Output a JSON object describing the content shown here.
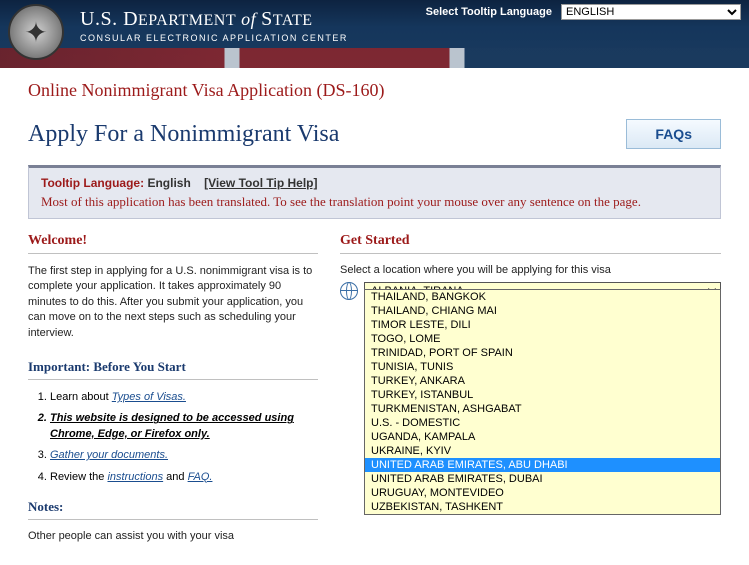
{
  "header": {
    "dept_us": "U.S. ",
    "dept_d": "D",
    "dept_ept": "EPARTMENT",
    "dept_of": " of ",
    "dept_s": "S",
    "dept_tate": "TATE",
    "sub": "CONSULAR ELECTRONIC APPLICATION CENTER",
    "tooltip_label": "Select Tooltip Language",
    "tooltip_selected": "ENGLISH"
  },
  "app_title": "Online Nonimmigrant Visa Application (DS-160)",
  "page_title": "Apply For a Nonimmigrant Visa",
  "faqs": "FAQs",
  "infobar": {
    "tl_label": "Tooltip Language:",
    "tl_value": "English",
    "tl_help": "[View Tool Tip Help]",
    "translate_note": "Most of this application has been translated. To see the translation point your mouse over any sentence on the page."
  },
  "welcome": {
    "head": "Welcome!",
    "text": "The first step in applying for a U.S. nonimmigrant visa is to complete your application. It takes approximately 90 minutes to do this. After you submit your application, you can move on to the next steps such as scheduling your interview."
  },
  "before": {
    "head": "Important: Before You Start",
    "s1_pre": "Learn about ",
    "s1_link": "Types of Visas.",
    "s2": "This website is designed to be accessed using Chrome, Edge, or Firefox only.",
    "s3": "Gather your documents.",
    "s4_pre": "Review the ",
    "s4_link1": "instructions",
    "s4_mid": " and ",
    "s4_link2": "FAQ.",
    "notes_head": "Notes:",
    "notes_text": "Other people can assist you with your visa"
  },
  "getstarted": {
    "head": "Get Started",
    "label": "Select a location where you will be applying for this visa",
    "selected": "ALBANIA, TIRANA",
    "options": [
      "THAILAND, BANGKOK",
      "THAILAND, CHIANG MAI",
      "TIMOR LESTE, DILI",
      "TOGO, LOME",
      "TRINIDAD, PORT OF SPAIN",
      "TUNISIA, TUNIS",
      "TURKEY, ANKARA",
      "TURKEY, ISTANBUL",
      "TURKMENISTAN, ASHGABAT",
      "U.S. - DOMESTIC",
      "UGANDA, KAMPALA",
      "UKRAINE, KYIV",
      "UNITED ARAB EMIRATES, ABU DHABI",
      "UNITED ARAB EMIRATES, DUBAI",
      "URUGUAY, MONTEVIDEO",
      "UZBEKISTAN, TASHKENT"
    ],
    "highlighted": "UNITED ARAB EMIRATES, ABU DHABI"
  }
}
